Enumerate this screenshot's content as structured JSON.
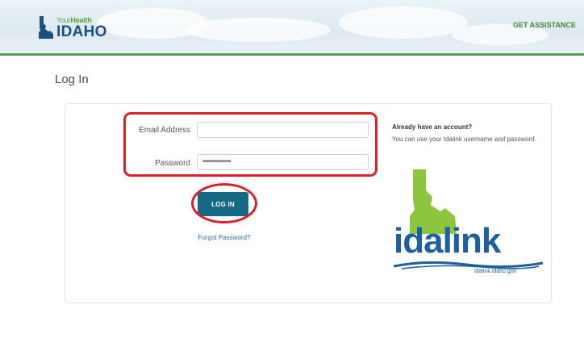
{
  "header": {
    "logo_small_prefix": "Your",
    "logo_small_bold": "Health",
    "logo_main": "IDAHO",
    "assistance_link": "GET ASSISTANCE"
  },
  "page": {
    "title": "Log In"
  },
  "form": {
    "email_label": "Email Address",
    "email_value": "",
    "password_label": "Password",
    "password_value": "••••••••••••••",
    "login_button": "LOG IN",
    "forgot_link": "Forgot Password?"
  },
  "sidebar": {
    "title": "Already have an account?",
    "text": "You can use your Idalink username and password.",
    "logo_word": "idalink",
    "logo_url": "idalink.idaho.gov"
  },
  "colors": {
    "brand_blue": "#1f4f82",
    "brand_green": "#5aa23a",
    "button": "#156a85",
    "highlight": "#d9202c"
  }
}
